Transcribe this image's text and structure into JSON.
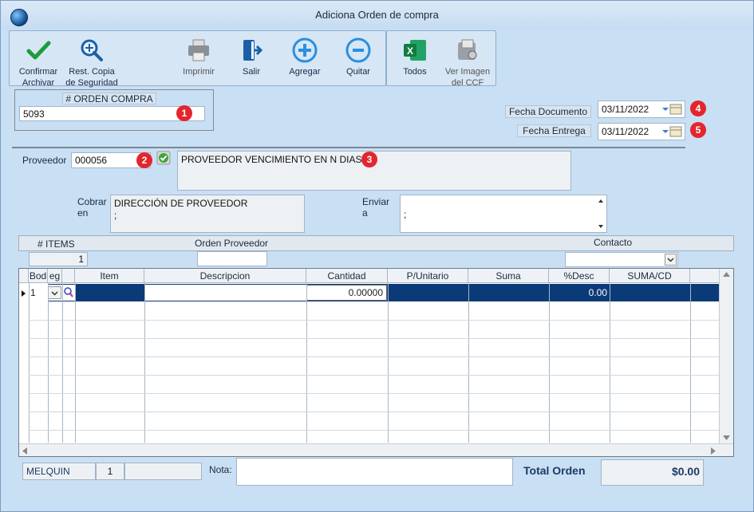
{
  "window": {
    "title": "Adiciona Orden de compra"
  },
  "toolbar": {
    "confirm": "Confirmar\nArchivar",
    "restore": "Rest. Copia\nde Seguridad",
    "print": "Imprimir",
    "exit": "Salir",
    "add": "Agregar",
    "remove": "Quitar",
    "excel_all": "Todos",
    "view_image": "Ver Imagen\ndel CCF"
  },
  "order": {
    "caption": "# ORDEN COMPRA",
    "number": "5093"
  },
  "dates": {
    "doc_label": "Fecha Documento",
    "doc_value": "03/11/2022",
    "delivery_label": "Fecha Entrega",
    "delivery_value": "03/11/2022"
  },
  "badges": {
    "b1": "1",
    "b2": "2",
    "b3": "3",
    "b4": "4",
    "b5": "5"
  },
  "supplier": {
    "label": "Proveedor",
    "code": "000056",
    "name": "PROVEEDOR VENCIMIENTO EN N DIAS",
    "cobrar_label": "Cobrar\nen",
    "cobrar_line1": "DIRECCIÓN DE PROVEEDOR",
    "cobrar_line2": ";",
    "enviar_label": "Enviar\na",
    "enviar_value": ";"
  },
  "header": {
    "items_label": "# ITEMS",
    "items_value": "1",
    "orden_proveedor_label": "Orden Proveedor",
    "orden_proveedor_value": "",
    "contacto_label": "Contacto",
    "contacto_value": ""
  },
  "grid": {
    "columns": [
      "Bod",
      "eg",
      "",
      "Item",
      "Descripcion",
      "Cantidad",
      "P/Unitario",
      "Suma",
      "%Desc",
      "SUMA/CD"
    ],
    "row1": {
      "bod": "1",
      "cantidad": "0.00000",
      "desc": "0.00"
    }
  },
  "footer": {
    "user": "MELQUIN",
    "num": "1",
    "extra": "",
    "nota_label": "Nota:",
    "nota_value": "",
    "total_label": "Total Orden",
    "total_value": "$0.00"
  },
  "colors": {
    "accent": "#0b3a78",
    "badge": "#e3262d",
    "window_bg": "#c9dff4"
  }
}
